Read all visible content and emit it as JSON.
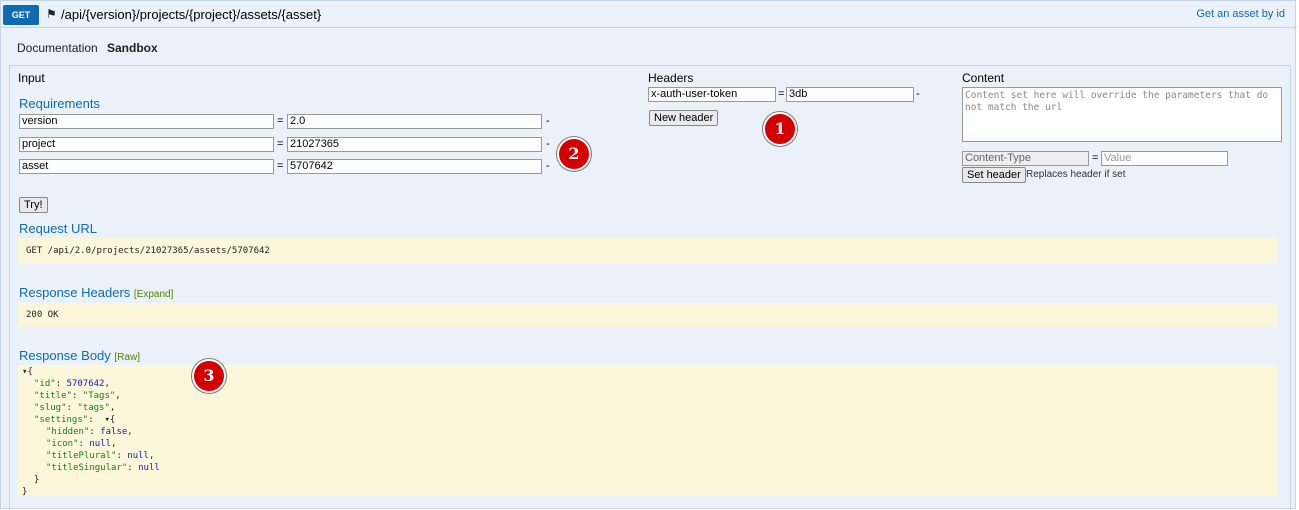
{
  "topbar": {
    "method": "GET",
    "path": "/api/{version}/projects/{project}/assets/{asset}",
    "summary": "Get an asset by id"
  },
  "tabs": [
    {
      "label": "Documentation"
    },
    {
      "label": "Sandbox"
    }
  ],
  "input": {
    "title": "Input",
    "requirements_title": "Requirements",
    "params": [
      {
        "name": "version",
        "value": "2.0"
      },
      {
        "name": "project",
        "value": "21027365"
      },
      {
        "name": "asset",
        "value": "5707642"
      }
    ],
    "equals": "=",
    "dash": "-",
    "try_label": "Try!"
  },
  "headers": {
    "title": "Headers",
    "items": [
      {
        "name": "x-auth-user-token",
        "value": "3db"
      }
    ],
    "new_header_label": "New header"
  },
  "content": {
    "title": "Content",
    "textarea_placeholder": "Content set here will override the parameters that do not match the url",
    "content_type_label": "Content-Type",
    "value_placeholder": "Value",
    "set_header_label": "Set header",
    "set_header_note": "Replaces header if set"
  },
  "request": {
    "title": "Request URL",
    "url": "GET /api/2.0/projects/21027365/assets/5707642"
  },
  "response_headers": {
    "title": "Response Headers",
    "expand_label": "[Expand]",
    "status": "200 OK"
  },
  "response_body": {
    "title": "Response Body",
    "raw_label": "[Raw]",
    "lines": {
      "l0": "▾{",
      "l1a": "\"id\"",
      "l1b": ": ",
      "l1c": "5707642",
      "l1d": ",",
      "l2a": "\"title\"",
      "l2b": ": ",
      "l2c": "\"Tags\"",
      "l2d": ",",
      "l3a": "\"slug\"",
      "l3b": ": ",
      "l3c": "\"tags\"",
      "l3d": ",",
      "l4a": "\"settings\"",
      "l4b": ":  ▾{",
      "l5a": "\"hidden\"",
      "l5b": ": ",
      "l5c": "false",
      "l5d": ",",
      "l6a": "\"icon\"",
      "l6b": ": ",
      "l6c": "null",
      "l6d": ",",
      "l7a": "\"titlePlural\"",
      "l7b": ": ",
      "l7c": "null",
      "l7d": ",",
      "l8a": "\"titleSingular\"",
      "l8b": ": ",
      "l8c": "null",
      "l9": "}",
      "l10": "}"
    }
  },
  "markers": [
    "1",
    "2",
    "3"
  ],
  "colors": {
    "accent": "#0f6ab4",
    "panel_bg": "#eaf1f8",
    "code_bg": "#fcf6db",
    "marker_red": "#d40000"
  }
}
